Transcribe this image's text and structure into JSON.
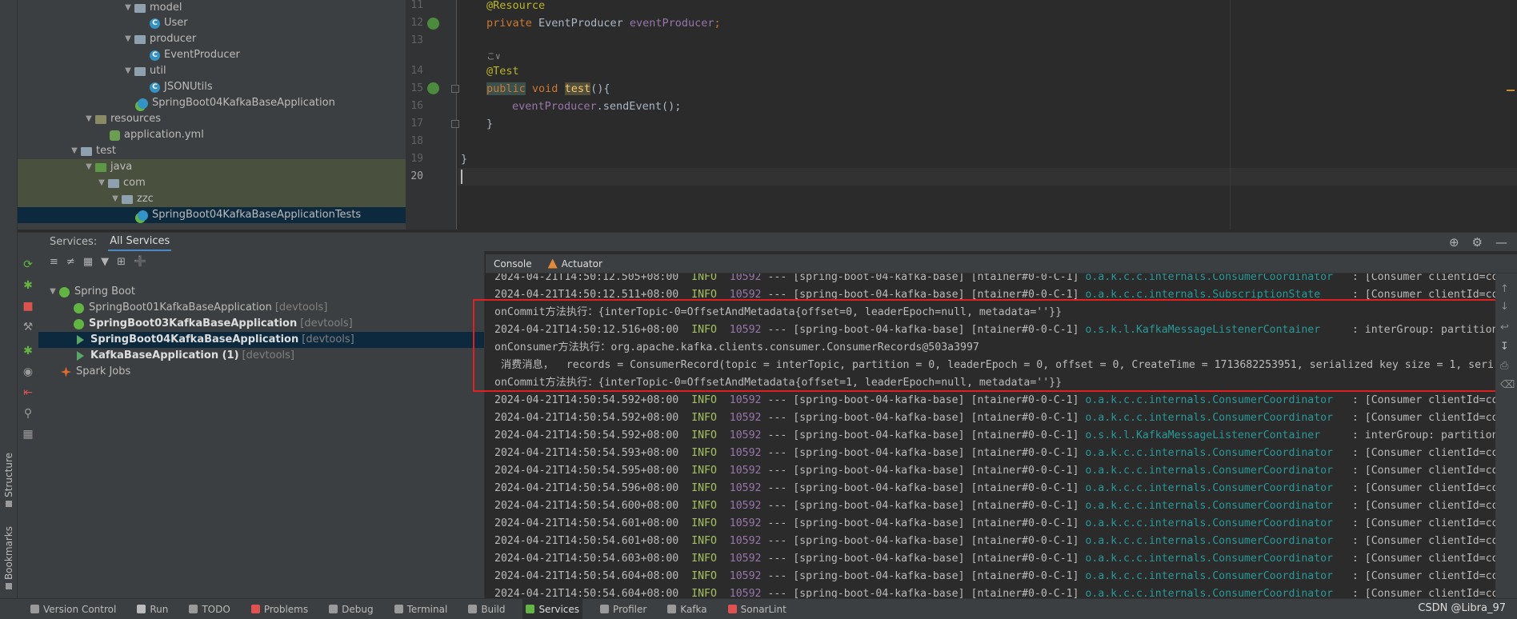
{
  "left_stripe": {
    "structure_label": "Structure",
    "bookmarks_label": "Bookmarks"
  },
  "project_tree": [
    {
      "label": "model",
      "kind": "folder"
    },
    {
      "label": "User",
      "kind": "class"
    },
    {
      "label": "producer",
      "kind": "folder"
    },
    {
      "label": "EventProducer",
      "kind": "class"
    },
    {
      "label": "util",
      "kind": "folder"
    },
    {
      "label": "JSONUtils",
      "kind": "class"
    },
    {
      "label": "SpringBoot04KafkaBaseApplication",
      "kind": "spring-class"
    },
    {
      "label": "resources",
      "kind": "folder"
    },
    {
      "label": "application.yml",
      "kind": "yml"
    },
    {
      "label": "test",
      "kind": "folder"
    },
    {
      "label": "java",
      "kind": "folder"
    },
    {
      "label": "com",
      "kind": "folder"
    },
    {
      "label": "zzc",
      "kind": "folder"
    },
    {
      "label": "SpringBoot04KafkaBaseApplicationTests",
      "kind": "class"
    }
  ],
  "editor": {
    "line_numbers": [
      "11",
      "12",
      "13",
      "14",
      "15",
      "16",
      "17",
      "18",
      "19",
      "20"
    ],
    "code": {
      "l11_annotation": "@Resource",
      "l12_kw": "private",
      "l12_type": "EventProducer",
      "l12_field": "eventProducer",
      "l12_end": ";",
      "l13_inlay": "こ∨",
      "l14_annotation": "@Test",
      "l15_kw1": "public",
      "l15_kw2": "void",
      "l15_method": "test",
      "l15_end": "(){",
      "l16_field": "eventProducer",
      "l16_call": ".sendEvent();",
      "l17": "}",
      "l19": "}"
    }
  },
  "services": {
    "title": "Services:",
    "tab": "All Services",
    "tree": [
      {
        "label": "Spring Boot",
        "bold": false,
        "devtools": ""
      },
      {
        "label": "SpringBoot01KafkaBaseApplication",
        "bold": false,
        "devtools": "[devtools]"
      },
      {
        "label": "SpringBoot03KafkaBaseApplication",
        "bold": true,
        "devtools": "[devtools]"
      },
      {
        "label": "SpringBoot04KafkaBaseApplication",
        "bold": true,
        "devtools": "[devtools]"
      },
      {
        "label": "KafkaBaseApplication (1)",
        "bold": true,
        "devtools": "[devtools]"
      },
      {
        "label": "Spark Jobs",
        "bold": false,
        "devtools": ""
      }
    ]
  },
  "console_tabs": [
    "Console",
    "Actuator"
  ],
  "console_lines": [
    {
      "type": "log",
      "ts": "2024-04-21T14:50:12.505+08:00",
      "level": "INFO",
      "pid": "10592",
      "mid": " --- [spring-boot-04-kafka-base] [ntainer#0-0-C-1] ",
      "logger": "o.a.k.c.c.internals.ConsumerCoordinator  ",
      "msg": " : [Consumer clientId=con"
    },
    {
      "type": "log",
      "ts": "2024-04-21T14:50:12.511+08:00",
      "level": "INFO",
      "pid": "10592",
      "mid": " --- [spring-boot-04-kafka-base] [ntainer#0-0-C-1] ",
      "logger": "o.a.k.c.c.internals.SubscriptionState    ",
      "msg": " : [Consumer clientId=con"
    },
    {
      "type": "plain",
      "text": "onCommit方法执行：{interTopic-0=OffsetAndMetadata{offset=0, leaderEpoch=null, metadata=''}}"
    },
    {
      "type": "log",
      "ts": "2024-04-21T14:50:12.516+08:00",
      "level": "INFO",
      "pid": "10592",
      "mid": " --- [spring-boot-04-kafka-base] [ntainer#0-0-C-1] ",
      "logger": "o.s.k.l.KafkaMessageListenerContainer    ",
      "msg": " : interGroup: partitions"
    },
    {
      "type": "plain",
      "text": "onConsumer方法执行：org.apache.kafka.clients.consumer.ConsumerRecords@503a3997"
    },
    {
      "type": "plain",
      "text": " 消费消息，  records = ConsumerRecord(topic = interTopic, partition = 0, leaderEpoch = 0, offset = 0, CreateTime = 1713682253951, serialized key size = 1, seri"
    },
    {
      "type": "plain",
      "text": "onCommit方法执行：{interTopic-0=OffsetAndMetadata{offset=1, leaderEpoch=null, metadata=''}}"
    },
    {
      "type": "log",
      "ts": "2024-04-21T14:50:54.592+08:00",
      "level": "INFO",
      "pid": "10592",
      "mid": " --- [spring-boot-04-kafka-base] [ntainer#0-0-C-1] ",
      "logger": "o.a.k.c.c.internals.ConsumerCoordinator  ",
      "msg": " : [Consumer clientId=con"
    },
    {
      "type": "log",
      "ts": "2024-04-21T14:50:54.592+08:00",
      "level": "INFO",
      "pid": "10592",
      "mid": " --- [spring-boot-04-kafka-base] [ntainer#0-0-C-1] ",
      "logger": "o.a.k.c.c.internals.ConsumerCoordinator  ",
      "msg": " : [Consumer clientId=con"
    },
    {
      "type": "log",
      "ts": "2024-04-21T14:50:54.592+08:00",
      "level": "INFO",
      "pid": "10592",
      "mid": " --- [spring-boot-04-kafka-base] [ntainer#0-0-C-1] ",
      "logger": "o.s.k.l.KafkaMessageListenerContainer    ",
      "msg": " : interGroup: partitions"
    },
    {
      "type": "log",
      "ts": "2024-04-21T14:50:54.593+08:00",
      "level": "INFO",
      "pid": "10592",
      "mid": " --- [spring-boot-04-kafka-base] [ntainer#0-0-C-1] ",
      "logger": "o.a.k.c.c.internals.ConsumerCoordinator  ",
      "msg": " : [Consumer clientId=con"
    },
    {
      "type": "log",
      "ts": "2024-04-21T14:50:54.595+08:00",
      "level": "INFO",
      "pid": "10592",
      "mid": " --- [spring-boot-04-kafka-base] [ntainer#0-0-C-1] ",
      "logger": "o.a.k.c.c.internals.ConsumerCoordinator  ",
      "msg": " : [Consumer clientId=con"
    },
    {
      "type": "log",
      "ts": "2024-04-21T14:50:54.596+08:00",
      "level": "INFO",
      "pid": "10592",
      "mid": " --- [spring-boot-04-kafka-base] [ntainer#0-0-C-1] ",
      "logger": "o.a.k.c.c.internals.ConsumerCoordinator  ",
      "msg": " : [Consumer clientId=con"
    },
    {
      "type": "log",
      "ts": "2024-04-21T14:50:54.600+08:00",
      "level": "INFO",
      "pid": "10592",
      "mid": " --- [spring-boot-04-kafka-base] [ntainer#0-0-C-1] ",
      "logger": "o.a.k.c.c.internals.ConsumerCoordinator  ",
      "msg": " : [Consumer clientId=con"
    },
    {
      "type": "log",
      "ts": "2024-04-21T14:50:54.601+08:00",
      "level": "INFO",
      "pid": "10592",
      "mid": " --- [spring-boot-04-kafka-base] [ntainer#0-0-C-1] ",
      "logger": "o.a.k.c.c.internals.ConsumerCoordinator  ",
      "msg": " : [Consumer clientId=con"
    },
    {
      "type": "log",
      "ts": "2024-04-21T14:50:54.601+08:00",
      "level": "INFO",
      "pid": "10592",
      "mid": " --- [spring-boot-04-kafka-base] [ntainer#0-0-C-1] ",
      "logger": "o.a.k.c.c.internals.ConsumerCoordinator  ",
      "msg": " : [Consumer clientId=con"
    },
    {
      "type": "log",
      "ts": "2024-04-21T14:50:54.603+08:00",
      "level": "INFO",
      "pid": "10592",
      "mid": " --- [spring-boot-04-kafka-base] [ntainer#0-0-C-1] ",
      "logger": "o.a.k.c.c.internals.ConsumerCoordinator  ",
      "msg": " : [Consumer clientId=con"
    },
    {
      "type": "log",
      "ts": "2024-04-21T14:50:54.604+08:00",
      "level": "INFO",
      "pid": "10592",
      "mid": " --- [spring-boot-04-kafka-base] [ntainer#0-0-C-1] ",
      "logger": "o.a.k.c.c.internals.ConsumerCoordinator  ",
      "msg": " : [Consumer clientId=con"
    },
    {
      "type": "log",
      "ts": "2024-04-21T14:50:54.604+08:00",
      "level": "INFO",
      "pid": "10592",
      "mid": " --- [spring-boot-04-kafka-base] [ntainer#0-0-C-1] ",
      "logger": "o.a.k.c.c.internals.ConsumerCoordinator  ",
      "msg": " : [Consumer clientId=con"
    }
  ],
  "bottom_tools": [
    {
      "label": "Version Control",
      "icon": "branch-icon",
      "color": "#9a9a9a"
    },
    {
      "label": "Run",
      "icon": "run-icon",
      "color": "#bbbbbb"
    },
    {
      "label": "TODO",
      "icon": "todo-icon",
      "color": "#9a9a9a"
    },
    {
      "label": "Problems",
      "icon": "problems-icon",
      "color": "#e05252"
    },
    {
      "label": "Debug",
      "icon": "bug-icon",
      "color": "#9a9a9a"
    },
    {
      "label": "Terminal",
      "icon": "terminal-icon",
      "color": "#9a9a9a"
    },
    {
      "label": "Build",
      "icon": "hammer-icon",
      "color": "#9a9a9a"
    },
    {
      "label": "Services",
      "icon": "services-icon",
      "color": "#62b543"
    },
    {
      "label": "Profiler",
      "icon": "profiler-icon",
      "color": "#9a9a9a"
    },
    {
      "label": "Kafka",
      "icon": "kafka-icon",
      "color": "#9a9a9a"
    },
    {
      "label": "SonarLint",
      "icon": "sonarlint-icon",
      "color": "#e05252"
    }
  ],
  "watermark": "CSDN @Libra_97",
  "colors": {
    "accent": "#4a88c7",
    "highlight_box": "#e0201f",
    "log_info": "#a5c261",
    "log_pid": "#9876aa",
    "log_logger": "#299999"
  }
}
